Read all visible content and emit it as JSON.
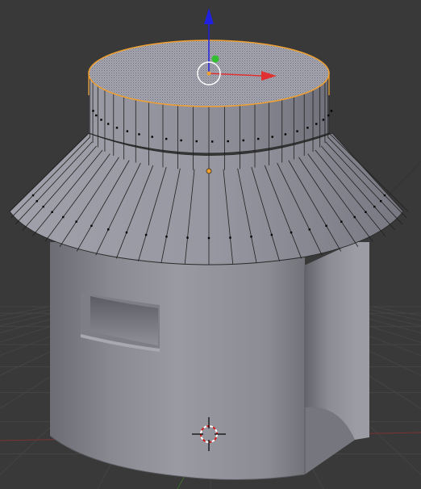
{
  "viewport": {
    "background": "#393939",
    "grid_line_color": "#444444",
    "x_axis_line_color": "#7a3333",
    "y_axis_line_color": "#3d6b2c"
  },
  "model": {
    "wall_color": "#8a8a92",
    "roof_color": "#8e8e98",
    "edge_color": "#1f1f1f",
    "vertex_color": "#000000"
  },
  "selection": {
    "outline_color": "#f0a030",
    "face_fill": "#a4a4b0",
    "face_dot_pattern": "#6e6e78"
  },
  "gizmo": {
    "x_axis_color": "#e03030",
    "y_axis_color": "#30c030",
    "z_axis_color": "#2020e0",
    "center_icon": "pivot-circle-icon"
  },
  "cursor_3d": {
    "icon": "3d-cursor-icon",
    "ring_color_a": "#d02020",
    "ring_color_b": "#ffffff"
  }
}
